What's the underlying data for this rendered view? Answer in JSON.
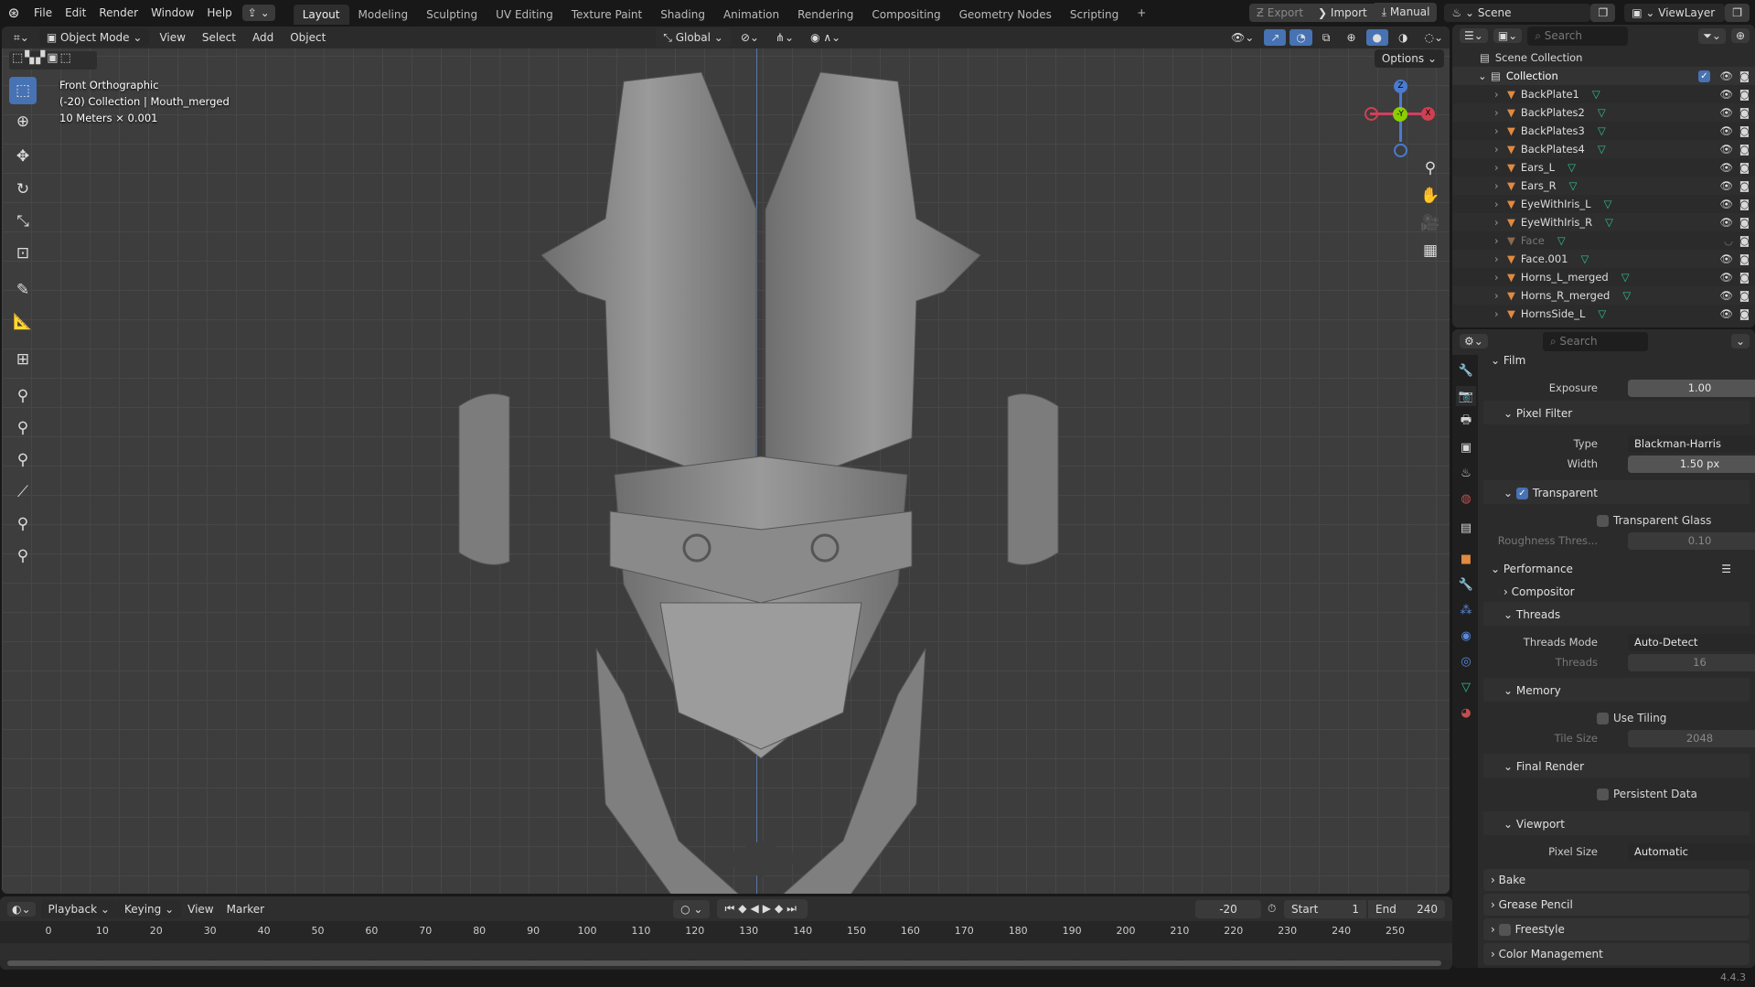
{
  "menubar": {
    "items": [
      "File",
      "Edit",
      "Render",
      "Window",
      "Help"
    ],
    "workspaces": [
      "Layout",
      "Modeling",
      "Sculpting",
      "UV Editing",
      "Texture Paint",
      "Shading",
      "Animation",
      "Rendering",
      "Compositing",
      "Geometry Nodes",
      "Scripting"
    ],
    "active_workspace": "Layout",
    "add_workspace": "+",
    "export": "Export",
    "import": "Import",
    "manual": "Manual",
    "scene": "Scene",
    "view_layer": "ViewLayer"
  },
  "viewport": {
    "mode": "Object Mode",
    "menus": [
      "View",
      "Select",
      "Add",
      "Object"
    ],
    "orientation": "Global",
    "options": "Options",
    "view_name": "Front Orthographic",
    "context": "(-20) Collection | Mouth_merged",
    "scale": "10 Meters × 0.001",
    "gizmo": {
      "z": "Z",
      "y": "-Y",
      "x": "X"
    }
  },
  "outliner": {
    "search_placeholder": "Search",
    "scene_collection": "Scene Collection",
    "collection": "Collection",
    "items": [
      {
        "name": "BackPlate1",
        "visible": true
      },
      {
        "name": "BackPlates2",
        "visible": true
      },
      {
        "name": "BackPlates3",
        "visible": true
      },
      {
        "name": "BackPlates4",
        "visible": true
      },
      {
        "name": "Ears_L",
        "visible": true
      },
      {
        "name": "Ears_R",
        "visible": true
      },
      {
        "name": "EyeWithIris_L",
        "visible": true
      },
      {
        "name": "EyeWithIris_R",
        "visible": true
      },
      {
        "name": "Face",
        "visible": false
      },
      {
        "name": "Face.001",
        "visible": true
      },
      {
        "name": "Horns_L_merged",
        "visible": true
      },
      {
        "name": "Horns_R_merged",
        "visible": true
      },
      {
        "name": "HornsSide_L",
        "visible": true
      }
    ]
  },
  "properties": {
    "search_placeholder": "Search",
    "film": "Film",
    "exposure_label": "Exposure",
    "exposure": "1.00",
    "pixel_filter": "Pixel Filter",
    "type_label": "Type",
    "type": "Blackman-Harris",
    "width_label": "Width",
    "width": "1.50 px",
    "transparent": "Transparent",
    "transparent_glass": "Transparent Glass",
    "roughness_label": "Roughness Thres...",
    "roughness": "0.10",
    "performance": "Performance",
    "compositor": "Compositor",
    "threads": "Threads",
    "threads_mode_label": "Threads Mode",
    "threads_mode": "Auto-Detect",
    "threads_label": "Threads",
    "threads_value": "16",
    "memory": "Memory",
    "use_tiling": "Use Tiling",
    "tile_size_label": "Tile Size",
    "tile_size": "2048",
    "final_render": "Final Render",
    "persistent_data": "Persistent Data",
    "viewport": "Viewport",
    "pixel_size_label": "Pixel Size",
    "pixel_size": "Automatic",
    "bake": "Bake",
    "grease_pencil": "Grease Pencil",
    "freestyle": "Freestyle",
    "color_management": "Color Management"
  },
  "timeline": {
    "menus": [
      "Playback",
      "Keying",
      "View",
      "Marker"
    ],
    "current_frame": "-20",
    "start_label": "Start",
    "start": "1",
    "end_label": "End",
    "end": "240",
    "ticks": [
      "0",
      "10",
      "20",
      "30",
      "40",
      "50",
      "60",
      "70",
      "80",
      "90",
      "100",
      "110",
      "120",
      "130",
      "140",
      "150",
      "160",
      "170",
      "180",
      "190",
      "200",
      "210",
      "220",
      "230",
      "240",
      "250"
    ]
  },
  "status": {
    "version": "4.4.3"
  }
}
